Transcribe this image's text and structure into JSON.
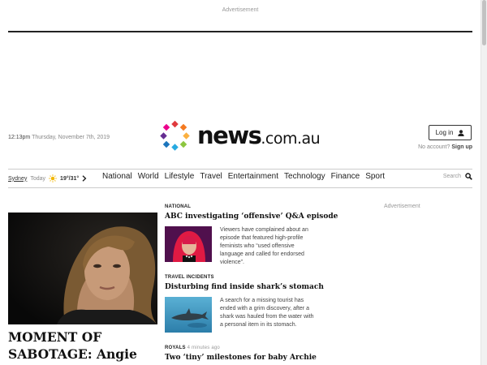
{
  "advertisement_top": "Advertisement",
  "header": {
    "time": "12:13pm",
    "date": "Thursday, November 7th, 2019",
    "logo": {
      "news": "news",
      "domain": ".com.au"
    },
    "login_label": "Log in",
    "no_account_text": "No account?",
    "signup_label": "Sign up"
  },
  "weather": {
    "city": "Sydney",
    "day": "Today",
    "temps": "19°/31°",
    "icon": "sun-icon"
  },
  "nav": {
    "items": [
      "National",
      "World",
      "Lifestyle",
      "Travel",
      "Entertainment",
      "Technology",
      "Finance",
      "Sport"
    ],
    "search_label": "Search"
  },
  "hero": {
    "title": "MOMENT OF SABOTAGE: Angie left in tears after"
  },
  "stories": [
    {
      "category": "NATIONAL",
      "time_ago": "",
      "headline": "ABC investigating ‘offensive’ Q&A episode",
      "summary": "Viewers have complained about an episode that featured high-profile feminists who “used offensive language and called for endorsed violence”."
    },
    {
      "category": "TRAVEL INCIDENTS",
      "time_ago": "",
      "headline": "Disturbing find inside shark’s stomach",
      "summary": "A search for a missing tourist has ended with a grim discovery, after a shark was hauled from the water with a personal item in its stomach."
    },
    {
      "category": "ROYALS",
      "time_ago": "4 minutes ago",
      "headline": "Two ‘tiny’ milestones for baby Archie"
    }
  ],
  "advertisement_side": "Advertisement",
  "colors": {
    "text": "#222222",
    "rule": "#222222",
    "divider": "#cccccc",
    "muted": "#999999",
    "sun": "#f2b705"
  }
}
